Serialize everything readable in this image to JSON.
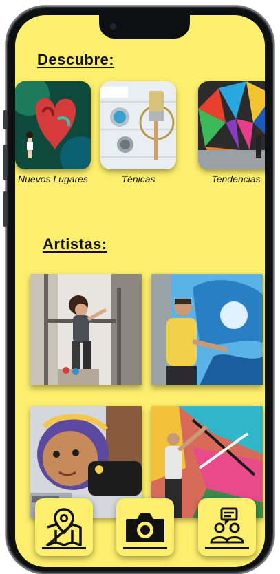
{
  "discover": {
    "title": "Descubre:",
    "categories": [
      {
        "label": "Nuevos Lugares",
        "icon": "heart-mural-image"
      },
      {
        "label": "Ténicas",
        "icon": "paint-tools-image"
      },
      {
        "label": "Tendencias",
        "icon": "geometric-mural-image"
      }
    ]
  },
  "artists": {
    "title": "Artistas:",
    "items": [
      {
        "icon": "artist-painting-wall-image"
      },
      {
        "icon": "artist-blue-mural-image"
      },
      {
        "icon": "child-portrait-mural-image"
      },
      {
        "icon": "artist-colorful-wall-image"
      }
    ]
  },
  "bottom_nav": [
    {
      "icon": "map-pin-icon"
    },
    {
      "icon": "camera-icon"
    },
    {
      "icon": "community-chat-icon"
    }
  ],
  "colors": {
    "background": "#fdef6d",
    "text": "#111111",
    "frame": "#2a2c30"
  }
}
